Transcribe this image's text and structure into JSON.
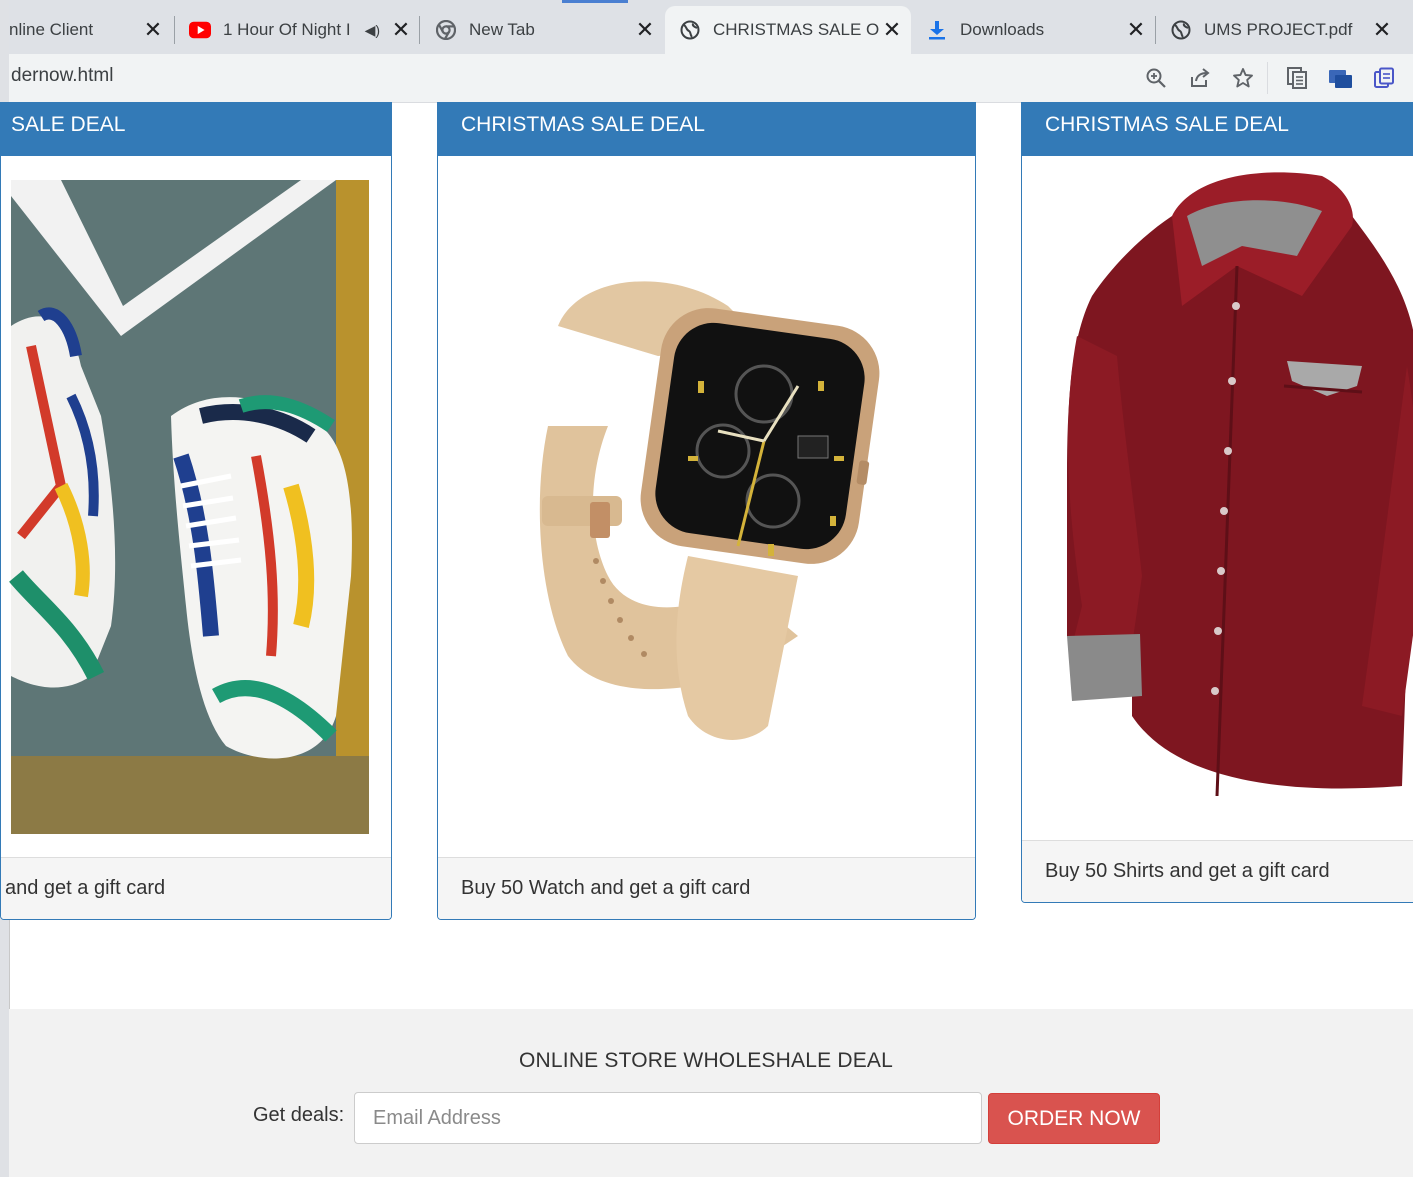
{
  "tabs": [
    {
      "title": "nline Client",
      "icon": "globe-icon"
    },
    {
      "title": "1 Hour Of Night I",
      "icon": "youtube-icon",
      "muted": true
    },
    {
      "title": "New Tab",
      "icon": "chrome-icon"
    },
    {
      "title": "CHRISTMAS SALE ORI",
      "icon": "globe-icon",
      "active": true
    },
    {
      "title": "Downloads",
      "icon": "download-icon"
    },
    {
      "title": "UMS PROJECT.pdf",
      "icon": "globe-icon"
    }
  ],
  "toolbar": {
    "url": "dernow.html"
  },
  "cards": [
    {
      "heading": "SALE DEAL",
      "caption": "and get a gift card",
      "image": "sneakers"
    },
    {
      "heading": "CHRISTMAS SALE DEAL",
      "caption": "Buy 50 Watch and get a gift card",
      "image": "watch"
    },
    {
      "heading": "CHRISTMAS SALE DEAL",
      "caption": "Buy 50 Shirts and get a gift card",
      "image": "shirt"
    }
  ],
  "footer": {
    "title": "ONLINE STORE WHOLESHALE DEAL",
    "deals_label": "Get deals:",
    "email_placeholder": "Email Address",
    "button_label": "ORDER NOW"
  },
  "colors": {
    "panel_header": "#337ab7",
    "button": "#d9534f",
    "footer_bg": "#f2f2f2"
  }
}
